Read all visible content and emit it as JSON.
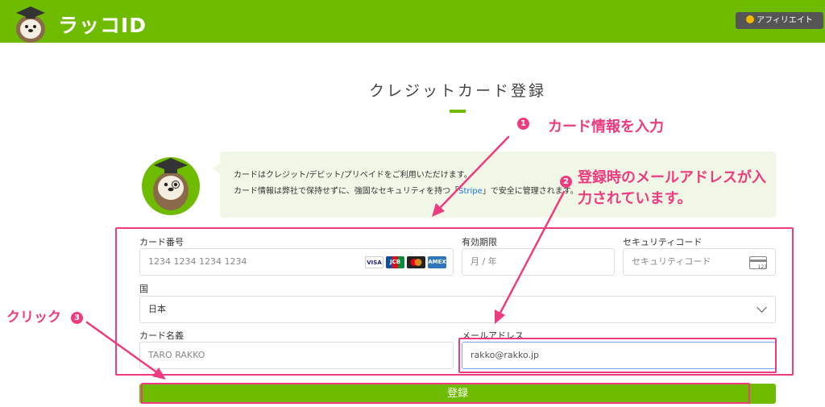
{
  "header": {
    "logo_text": "ラッコID",
    "affiliate_label": "アフィリエイト"
  },
  "page": {
    "title": "クレジットカード登録"
  },
  "info": {
    "line1": "カードはクレジット/デビット/プリペイドをご利用いただけます。",
    "line2_before": "カード情報は弊社で保持せずに、強固なセキュリティを持つ「",
    "line2_link": "Stripe",
    "line2_after": "」で安全に管理されます。"
  },
  "form": {
    "card_number_label": "カード番号",
    "card_number_placeholder": "1234 1234 1234 1234",
    "card_brands": [
      "VISA",
      "JCB",
      "MC",
      "AMEX"
    ],
    "expiry_label": "有効期限",
    "expiry_placeholder": "月 / 年",
    "security_label": "セキュリティコード",
    "security_placeholder": "セキュリティコード",
    "cvc_icon_text": "123",
    "country_label": "国",
    "country_value": "日本",
    "cardholder_label": "カード名義",
    "cardholder_placeholder": "TARO RAKKO",
    "email_label": "メールアドレス",
    "email_value": "rakko@rakko.jp",
    "submit_label": "登録"
  },
  "annotations": {
    "step1_num": "1",
    "step1_text": "カード情報を入力",
    "step2_num": "2",
    "step2_text_line1": "登録時のメールアドレスが入",
    "step2_text_line2": "力されています。",
    "step3_text": "クリック",
    "step3_num": "3",
    "color": "#ee3b7f"
  },
  "colors": {
    "brand_green": "#6ebb00",
    "info_bg": "#f1f7e6",
    "link_blue": "#1a73e8"
  }
}
